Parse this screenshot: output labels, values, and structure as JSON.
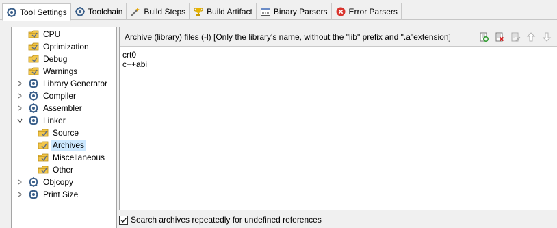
{
  "tabs": [
    {
      "label": "Tool Settings",
      "icon": "tool-settings-gear-icon",
      "active": true
    },
    {
      "label": "Toolchain",
      "icon": "toolchain-gear-icon"
    },
    {
      "label": "Build Steps",
      "icon": "build-steps-wand-icon"
    },
    {
      "label": "Build Artifact",
      "icon": "build-artifact-trophy-icon"
    },
    {
      "label": "Binary Parsers",
      "icon": "binary-parsers-icon"
    },
    {
      "label": "Error Parsers",
      "icon": "error-parsers-red-x-icon"
    }
  ],
  "tree": {
    "items": [
      {
        "label": "CPU",
        "icon": "settings-folder-icon",
        "expand": ""
      },
      {
        "label": "Optimization",
        "icon": "settings-folder-icon",
        "expand": ""
      },
      {
        "label": "Debug",
        "icon": "settings-folder-icon",
        "expand": ""
      },
      {
        "label": "Warnings",
        "icon": "settings-folder-icon",
        "expand": ""
      },
      {
        "label": "Library Generator",
        "icon": "tool-gear-icon",
        "expand": "collapsed"
      },
      {
        "label": "Compiler",
        "icon": "tool-gear-icon",
        "expand": "collapsed"
      },
      {
        "label": "Assembler",
        "icon": "tool-gear-icon",
        "expand": "collapsed"
      },
      {
        "label": "Linker",
        "icon": "tool-gear-icon",
        "expand": "expanded"
      },
      {
        "label": "Source",
        "icon": "settings-folder-icon",
        "expand": ""
      },
      {
        "label": "Archives",
        "icon": "settings-folder-icon",
        "expand": "",
        "selected": true
      },
      {
        "label": "Miscellaneous",
        "icon": "settings-folder-icon",
        "expand": ""
      },
      {
        "label": "Other",
        "icon": "settings-folder-icon",
        "expand": ""
      },
      {
        "label": "Objcopy",
        "icon": "tool-gear-icon",
        "expand": "collapsed"
      },
      {
        "label": "Print Size",
        "icon": "tool-gear-icon",
        "expand": "collapsed"
      }
    ]
  },
  "archives": {
    "title": "Archive (library) files (-l) [Only the library's name, without the \"lib\" prefix and \".a\"extension]",
    "items": [
      "crt0",
      "c++abi"
    ],
    "toolbar": [
      "add-icon",
      "delete-icon",
      "edit-icon",
      "move-up-icon",
      "move-down-icon"
    ]
  },
  "search_repeatedly": {
    "label": "Search archives repeatedly for undefined references",
    "checked": true
  },
  "colors": {
    "selection": "#cce8ff",
    "border": "#a5a5a5",
    "background": "#f0f0f0"
  }
}
